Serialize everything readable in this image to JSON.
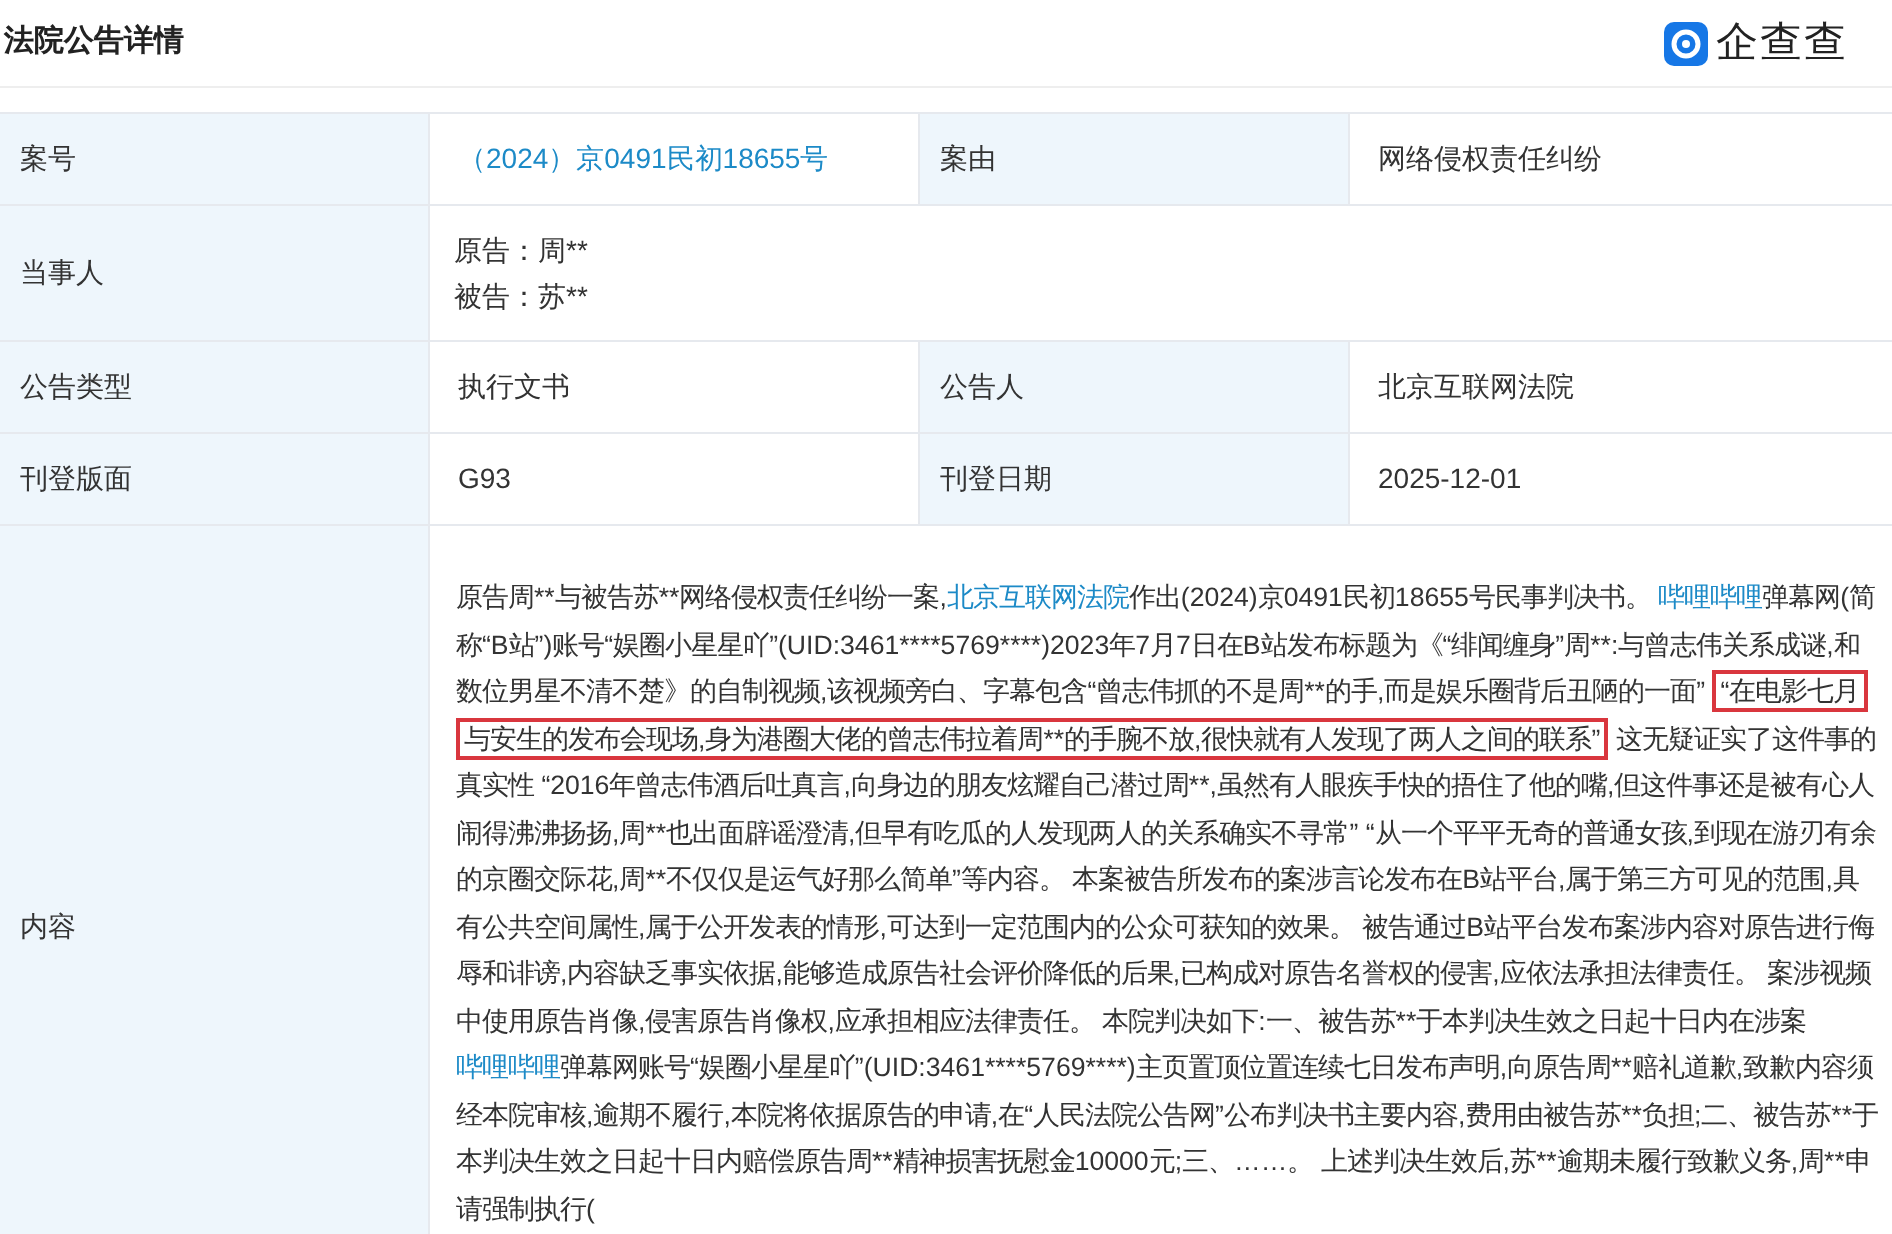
{
  "header": {
    "title": "法院公告详情",
    "brand": "企查查"
  },
  "fields": [
    {
      "label": "案号",
      "value": "（2024）京0491民初18655号",
      "kind": "link",
      "label2": "案由",
      "value2": "网络侵权责任纠纷"
    },
    {
      "label": "当事人",
      "lines": [
        "原告：周**",
        "被告：苏**"
      ],
      "kind": "parties"
    },
    {
      "label": "公告类型",
      "value": "执行文书",
      "kind": "plain",
      "label2": "公告人",
      "value2": "北京互联网法院"
    },
    {
      "label": "刊登版面",
      "value": "G93",
      "kind": "plain",
      "label2": "刊登日期",
      "value2": "2025-12-01"
    }
  ],
  "content": {
    "label": "内容",
    "segments": [
      {
        "kind": "plain",
        "text": "原告周**与被告苏**网络侵权责任纠纷一案,"
      },
      {
        "kind": "link",
        "text": "北京互联网法院"
      },
      {
        "kind": "plain",
        "text": "作出(2024)京0491民初18655号民事判决书。 "
      },
      {
        "kind": "link",
        "text": "哔哩哔哩"
      },
      {
        "kind": "plain",
        "text": "弹幕网(简称“B站”)账号“娱圈小星星吖”(UID:3461****5769****)2023年7月7日在B站发布标题为《“绯闻缠身”周**:与曾志伟关系成谜,和数位男星不清不楚》的自制视频,该视频旁白、字幕包含“曾志伟抓的不是周**的手,而是娱乐圈背后丑陋的一面” "
      },
      {
        "kind": "highlight",
        "text": "“在电影七月与安生的发布会现场,身为港圈大佬的曾志伟拉着周**的手腕不放,很快就有人发现了两人之间的联系”"
      },
      {
        "kind": "plain",
        "text": " 这无疑证实了这件事的真实性 “2016年曾志伟酒后吐真言,向身边的朋友炫耀自己潜过周**,虽然有人眼疾手快的捂住了他的嘴,但这件事还是被有心人闹得沸沸扬扬,周**也出面辟谣澄清,但早有吃瓜的人发现两人的关系确实不寻常” “从一个平平无奇的普通女孩,到现在游刃有余的京圈交际花,周**不仅仅是运气好那么简单”等内容。 本案被告所发布的案涉言论发布在B站平台,属于第三方可见的范围,具有公共空间属性,属于公开发表的情形,可达到一定范围内的公众可获知的效果。 被告通过B站平台发布案涉内容对原告进行侮辱和诽谤,内容缺乏事实依据,能够造成原告社会评价降低的后果,已构成对原告名誉权的侵害,应依法承担法律责任。 案涉视频中使用原告肖像,侵害原告肖像权,应承担相应法律责任。 本院判决如下:一、被告苏**于本判决生效之日起十日内在涉案"
      },
      {
        "kind": "link",
        "text": "哔哩哔哩"
      },
      {
        "kind": "plain",
        "text": "弹幕网账号“娱圈小星星吖”(UID:3461****5769****)主页置顶位置连续七日发布声明,向原告周**赔礼道歉,致歉内容须经本院审核,逾期不履行,本院将依据原告的申请,在“人民法院公告网”公布判决书主要内容,费用由被告苏**负担;二、被告苏**于本判决生效之日起十日内赔偿原告周**精神损害抚慰金10000元;三、……。 上述判决生效后,苏**逾期未履行致歉义务,周**申请强制执行("
      }
    ]
  }
}
